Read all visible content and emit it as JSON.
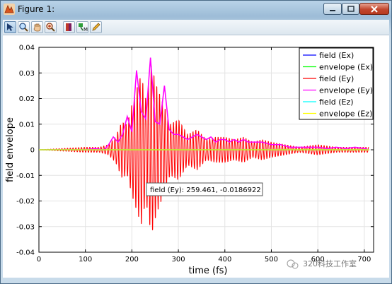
{
  "window": {
    "title": "Figure 1:"
  },
  "toolbar": {
    "buttons": [
      {
        "name": "select-tool-button",
        "icon": "arrow-pointer-icon"
      },
      {
        "name": "zoom-tool-button",
        "icon": "magnifier-icon"
      },
      {
        "name": "pan-tool-button",
        "icon": "hand-icon"
      },
      {
        "name": "zoom-in-tool-button",
        "icon": "magnifier-plus-icon"
      },
      {
        "name": "insert-colorbar-button",
        "icon": "colorbar-icon"
      },
      {
        "name": "data-cursor-button",
        "icon": "data-cursor-icon"
      },
      {
        "name": "edit-plot-button",
        "icon": "pencil-icon"
      }
    ]
  },
  "tooltip": {
    "text": "field (Ey): 259.461, -0.0186922"
  },
  "watermark": {
    "text": "320科技工作室"
  },
  "chart_data": {
    "type": "line",
    "title": "",
    "xlabel": "time (fs)",
    "ylabel": "field envelope",
    "xlim": [
      0,
      720
    ],
    "ylim": [
      -0.04,
      0.04
    ],
    "x_ticks": [
      0,
      100,
      200,
      300,
      400,
      500,
      600,
      700
    ],
    "y_ticks": [
      -0.04,
      -0.03,
      -0.02,
      -0.01,
      0,
      0.01,
      0.02,
      0.03,
      0.04
    ],
    "y_tick_labels": [
      "-0.04",
      "-0.03",
      "-0.02",
      "-0.01",
      "0",
      "0.01",
      "0.02",
      "0.03",
      "0.04"
    ],
    "grid": true,
    "legend_position": "top-right",
    "series": [
      {
        "name": "field (Ex)",
        "color": "#0000ff",
        "x": [
          0,
          710
        ],
        "y": [
          0,
          0
        ]
      },
      {
        "name": "envelope (Ex)",
        "color": "#00ff00",
        "x": [
          0,
          710
        ],
        "y": [
          0,
          0
        ]
      },
      {
        "name": "field (Ey)",
        "color": "#ff0000",
        "carrier_period_fs": 6,
        "x": [
          0,
          100,
          130,
          150,
          165,
          178,
          190,
          200,
          210,
          220,
          230,
          242,
          252,
          262,
          272,
          282,
          300,
          320,
          340,
          360,
          380,
          400,
          420,
          440,
          460,
          480,
          500,
          530,
          560,
          600,
          640,
          680,
          710
        ],
        "y": [
          0,
          0.001,
          0.001,
          0.002,
          0.005,
          0.011,
          0.01,
          0.018,
          0.024,
          0.03,
          0.02,
          0.034,
          0.026,
          0.021,
          0.016,
          0.01,
          0.012,
          0.006,
          0.008,
          0.004,
          0.005,
          0.005,
          0.004,
          0.005,
          0.003,
          0.004,
          0.003,
          0.002,
          0.001,
          0.002,
          0.001,
          0.001,
          0.001
        ]
      },
      {
        "name": "envelope (Ey)",
        "color": "#ff00ff",
        "x": [
          0,
          100,
          120,
          140,
          150,
          160,
          170,
          180,
          190,
          200,
          210,
          220,
          230,
          240,
          250,
          260,
          270,
          280,
          290,
          300,
          310,
          320,
          330,
          340,
          350,
          360,
          370,
          380,
          390,
          400,
          410,
          420,
          430,
          440,
          450,
          460,
          480,
          500,
          520,
          540,
          560,
          580,
          600,
          620,
          640,
          660,
          680,
          700,
          710
        ],
        "y": [
          0,
          0,
          0.0005,
          0,
          0.002,
          0.005,
          0.003,
          0.006,
          0.013,
          0.007,
          0.031,
          0.015,
          0.012,
          0.036,
          0.011,
          0.01,
          0.025,
          0.008,
          0.006,
          0.006,
          0.005,
          0.004,
          0.005,
          0.006,
          0.005,
          0.004,
          0.005,
          0.003,
          0.004,
          0.004,
          0.003,
          0.004,
          0.003,
          0.004,
          0.003,
          0.003,
          0.003,
          0.002,
          0.002,
          0.001,
          0.001,
          0.001,
          0.001,
          0.0005,
          0.001,
          0.0005,
          0.001,
          0.0005,
          0
        ]
      },
      {
        "name": "field (Ez)",
        "color": "#00ffff",
        "x": [
          0,
          710
        ],
        "y": [
          0,
          0
        ]
      },
      {
        "name": "envelope (Ez)",
        "color": "#ffff00",
        "x": [
          0,
          710
        ],
        "y": [
          0,
          0
        ]
      }
    ]
  }
}
